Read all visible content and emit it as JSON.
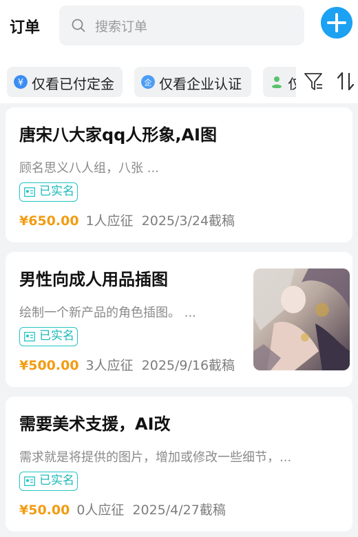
{
  "header": {
    "title": "订单",
    "search_placeholder": "搜索订单"
  },
  "filters": {
    "chips": [
      {
        "label": "仅看已付定金",
        "icon": "yen-coin-icon"
      },
      {
        "label": "仅看企业认证",
        "icon": "enterprise-badge-icon"
      },
      {
        "label": "仅",
        "icon": "person-icon"
      }
    ]
  },
  "colors": {
    "accent_blue": "#1da1f2",
    "price_orange": "#f29c12",
    "verified_teal": "#1fb9b9"
  },
  "orders": [
    {
      "title": "唐宋八大家qq人形象,AI图",
      "description": "顾名思义八人组，八张 ...",
      "badge": "已实名",
      "price": "¥650.00",
      "bidders": "1人应征",
      "deadline": "2025/3/24截稿",
      "has_image": false
    },
    {
      "title": "男性向成人用品插图",
      "description": "绘制一个新产品的角色插图。 ...",
      "badge": "已实名",
      "price": "¥500.00",
      "bidders": "3人应征",
      "deadline": "2025/9/16截稿",
      "has_image": true
    },
    {
      "title": "需要美术支援，AI改",
      "description": "需求就是将提供的图片，增加或修改一些细节，...",
      "badge": "已实名",
      "price": "¥50.00",
      "bidders": "0人应征",
      "deadline": "2025/4/27截稿",
      "has_image": false
    }
  ]
}
